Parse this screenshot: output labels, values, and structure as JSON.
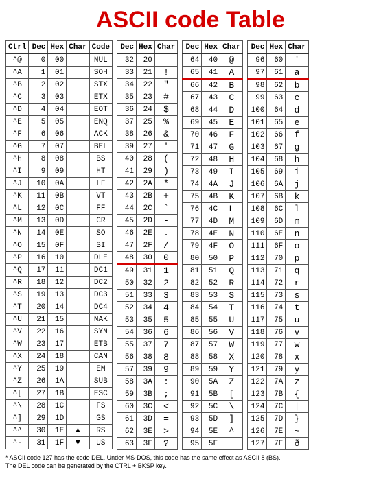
{
  "title": "ASCII code Table",
  "headers": {
    "ctrl": "Ctrl",
    "dec": "Dec",
    "hex": "Hex",
    "char": "Char",
    "code": "Code"
  },
  "footnote_1": "* ASCII code 127 has the code DEL. Under MS-DOS, this code has the same effect as ASCII 8 (BS).",
  "footnote_2": "  The DEL code can be generated by the CTRL + BKSP key.",
  "block1": [
    {
      "ctrl": "^@",
      "dec": 0,
      "hex": "00",
      "char": "",
      "code": "NUL"
    },
    {
      "ctrl": "^A",
      "dec": 1,
      "hex": "01",
      "char": "",
      "code": "SOH"
    },
    {
      "ctrl": "^B",
      "dec": 2,
      "hex": "02",
      "char": "",
      "code": "STX"
    },
    {
      "ctrl": "^C",
      "dec": 3,
      "hex": "03",
      "char": "",
      "code": "ETX"
    },
    {
      "ctrl": "^D",
      "dec": 4,
      "hex": "04",
      "char": "",
      "code": "EOT"
    },
    {
      "ctrl": "^E",
      "dec": 5,
      "hex": "05",
      "char": "",
      "code": "ENQ"
    },
    {
      "ctrl": "^F",
      "dec": 6,
      "hex": "06",
      "char": "",
      "code": "ACK"
    },
    {
      "ctrl": "^G",
      "dec": 7,
      "hex": "07",
      "char": "",
      "code": "BEL"
    },
    {
      "ctrl": "^H",
      "dec": 8,
      "hex": "08",
      "char": "",
      "code": "BS"
    },
    {
      "ctrl": "^I",
      "dec": 9,
      "hex": "09",
      "char": "",
      "code": "HT"
    },
    {
      "ctrl": "^J",
      "dec": 10,
      "hex": "0A",
      "char": "",
      "code": "LF"
    },
    {
      "ctrl": "^K",
      "dec": 11,
      "hex": "0B",
      "char": "",
      "code": "VT"
    },
    {
      "ctrl": "^L",
      "dec": 12,
      "hex": "0C",
      "char": "",
      "code": "FF"
    },
    {
      "ctrl": "^M",
      "dec": 13,
      "hex": "0D",
      "char": "",
      "code": "CR"
    },
    {
      "ctrl": "^N",
      "dec": 14,
      "hex": "0E",
      "char": "",
      "code": "SO"
    },
    {
      "ctrl": "^O",
      "dec": 15,
      "hex": "0F",
      "char": "",
      "code": "SI"
    },
    {
      "ctrl": "^P",
      "dec": 16,
      "hex": "10",
      "char": "",
      "code": "DLE"
    },
    {
      "ctrl": "^Q",
      "dec": 17,
      "hex": "11",
      "char": "",
      "code": "DC1"
    },
    {
      "ctrl": "^R",
      "dec": 18,
      "hex": "12",
      "char": "",
      "code": "DC2"
    },
    {
      "ctrl": "^S",
      "dec": 19,
      "hex": "13",
      "char": "",
      "code": "DC3"
    },
    {
      "ctrl": "^T",
      "dec": 20,
      "hex": "14",
      "char": "",
      "code": "DC4"
    },
    {
      "ctrl": "^U",
      "dec": 21,
      "hex": "15",
      "char": "",
      "code": "NAK"
    },
    {
      "ctrl": "^V",
      "dec": 22,
      "hex": "16",
      "char": "",
      "code": "SYN"
    },
    {
      "ctrl": "^W",
      "dec": 23,
      "hex": "17",
      "char": "",
      "code": "ETB"
    },
    {
      "ctrl": "^X",
      "dec": 24,
      "hex": "18",
      "char": "",
      "code": "CAN"
    },
    {
      "ctrl": "^Y",
      "dec": 25,
      "hex": "19",
      "char": "",
      "code": "EM"
    },
    {
      "ctrl": "^Z",
      "dec": 26,
      "hex": "1A",
      "char": "",
      "code": "SUB"
    },
    {
      "ctrl": "^[",
      "dec": 27,
      "hex": "1B",
      "char": "",
      "code": "ESC"
    },
    {
      "ctrl": "^\\",
      "dec": 28,
      "hex": "1C",
      "char": "",
      "code": "FS"
    },
    {
      "ctrl": "^]",
      "dec": 29,
      "hex": "1D",
      "char": "",
      "code": "GS"
    },
    {
      "ctrl": "^^",
      "dec": 30,
      "hex": "1E",
      "char": "▲",
      "code": "RS"
    },
    {
      "ctrl": "^-",
      "dec": 31,
      "hex": "1F",
      "char": "▼",
      "code": "US"
    }
  ],
  "block2": [
    {
      "dec": 32,
      "hex": "20",
      "char": " "
    },
    {
      "dec": 33,
      "hex": "21",
      "char": "!"
    },
    {
      "dec": 34,
      "hex": "22",
      "char": "\""
    },
    {
      "dec": 35,
      "hex": "23",
      "char": "#"
    },
    {
      "dec": 36,
      "hex": "24",
      "char": "$"
    },
    {
      "dec": 37,
      "hex": "25",
      "char": "%"
    },
    {
      "dec": 38,
      "hex": "26",
      "char": "&"
    },
    {
      "dec": 39,
      "hex": "27",
      "char": "'"
    },
    {
      "dec": 40,
      "hex": "28",
      "char": "("
    },
    {
      "dec": 41,
      "hex": "29",
      "char": ")"
    },
    {
      "dec": 42,
      "hex": "2A",
      "char": "*"
    },
    {
      "dec": 43,
      "hex": "2B",
      "char": "+"
    },
    {
      "dec": 44,
      "hex": "2C",
      "char": "`"
    },
    {
      "dec": 45,
      "hex": "2D",
      "char": "-"
    },
    {
      "dec": 46,
      "hex": "2E",
      "char": "."
    },
    {
      "dec": 47,
      "hex": "2F",
      "char": "/"
    },
    {
      "dec": 48,
      "hex": "30",
      "char": "0",
      "redline": true
    },
    {
      "dec": 49,
      "hex": "31",
      "char": "1"
    },
    {
      "dec": 50,
      "hex": "32",
      "char": "2"
    },
    {
      "dec": 51,
      "hex": "33",
      "char": "3"
    },
    {
      "dec": 52,
      "hex": "34",
      "char": "4"
    },
    {
      "dec": 53,
      "hex": "35",
      "char": "5"
    },
    {
      "dec": 54,
      "hex": "36",
      "char": "6"
    },
    {
      "dec": 55,
      "hex": "37",
      "char": "7"
    },
    {
      "dec": 56,
      "hex": "38",
      "char": "8"
    },
    {
      "dec": 57,
      "hex": "39",
      "char": "9"
    },
    {
      "dec": 58,
      "hex": "3A",
      "char": ":"
    },
    {
      "dec": 59,
      "hex": "3B",
      "char": ";"
    },
    {
      "dec": 60,
      "hex": "3C",
      "char": "<"
    },
    {
      "dec": 61,
      "hex": "3D",
      "char": "="
    },
    {
      "dec": 62,
      "hex": "3E",
      "char": ">"
    },
    {
      "dec": 63,
      "hex": "3F",
      "char": "?"
    }
  ],
  "block3": [
    {
      "dec": 64,
      "hex": "40",
      "char": "@"
    },
    {
      "dec": 65,
      "hex": "41",
      "char": "A",
      "redline": true
    },
    {
      "dec": 66,
      "hex": "42",
      "char": "B"
    },
    {
      "dec": 67,
      "hex": "43",
      "char": "C"
    },
    {
      "dec": 68,
      "hex": "44",
      "char": "D"
    },
    {
      "dec": 69,
      "hex": "45",
      "char": "E"
    },
    {
      "dec": 70,
      "hex": "46",
      "char": "F"
    },
    {
      "dec": 71,
      "hex": "47",
      "char": "G"
    },
    {
      "dec": 72,
      "hex": "48",
      "char": "H"
    },
    {
      "dec": 73,
      "hex": "49",
      "char": "I"
    },
    {
      "dec": 74,
      "hex": "4A",
      "char": "J"
    },
    {
      "dec": 75,
      "hex": "4B",
      "char": "K"
    },
    {
      "dec": 76,
      "hex": "4C",
      "char": "L"
    },
    {
      "dec": 77,
      "hex": "4D",
      "char": "M"
    },
    {
      "dec": 78,
      "hex": "4E",
      "char": "N"
    },
    {
      "dec": 79,
      "hex": "4F",
      "char": "O"
    },
    {
      "dec": 80,
      "hex": "50",
      "char": "P"
    },
    {
      "dec": 81,
      "hex": "51",
      "char": "Q"
    },
    {
      "dec": 82,
      "hex": "52",
      "char": "R"
    },
    {
      "dec": 83,
      "hex": "53",
      "char": "S"
    },
    {
      "dec": 84,
      "hex": "54",
      "char": "T"
    },
    {
      "dec": 85,
      "hex": "55",
      "char": "U"
    },
    {
      "dec": 86,
      "hex": "56",
      "char": "V"
    },
    {
      "dec": 87,
      "hex": "57",
      "char": "W"
    },
    {
      "dec": 88,
      "hex": "58",
      "char": "X"
    },
    {
      "dec": 89,
      "hex": "59",
      "char": "Y"
    },
    {
      "dec": 90,
      "hex": "5A",
      "char": "Z"
    },
    {
      "dec": 91,
      "hex": "5B",
      "char": "["
    },
    {
      "dec": 92,
      "hex": "5C",
      "char": "\\"
    },
    {
      "dec": 93,
      "hex": "5D",
      "char": "]"
    },
    {
      "dec": 94,
      "hex": "5E",
      "char": "^"
    },
    {
      "dec": 95,
      "hex": "5F",
      "char": "_"
    }
  ],
  "block4": [
    {
      "dec": 96,
      "hex": "60",
      "char": "'"
    },
    {
      "dec": 97,
      "hex": "61",
      "char": "a",
      "redline": true
    },
    {
      "dec": 98,
      "hex": "62",
      "char": "b"
    },
    {
      "dec": 99,
      "hex": "63",
      "char": "c"
    },
    {
      "dec": 100,
      "hex": "64",
      "char": "d"
    },
    {
      "dec": 101,
      "hex": "65",
      "char": "e"
    },
    {
      "dec": 102,
      "hex": "66",
      "char": "f"
    },
    {
      "dec": 103,
      "hex": "67",
      "char": "g"
    },
    {
      "dec": 104,
      "hex": "68",
      "char": "h"
    },
    {
      "dec": 105,
      "hex": "69",
      "char": "i"
    },
    {
      "dec": 106,
      "hex": "6A",
      "char": "j"
    },
    {
      "dec": 107,
      "hex": "6B",
      "char": "k"
    },
    {
      "dec": 108,
      "hex": "6C",
      "char": "l"
    },
    {
      "dec": 109,
      "hex": "6D",
      "char": "m"
    },
    {
      "dec": 110,
      "hex": "6E",
      "char": "n"
    },
    {
      "dec": 111,
      "hex": "6F",
      "char": "o"
    },
    {
      "dec": 112,
      "hex": "70",
      "char": "p"
    },
    {
      "dec": 113,
      "hex": "71",
      "char": "q"
    },
    {
      "dec": 114,
      "hex": "72",
      "char": "r"
    },
    {
      "dec": 115,
      "hex": "73",
      "char": "s"
    },
    {
      "dec": 116,
      "hex": "74",
      "char": "t"
    },
    {
      "dec": 117,
      "hex": "75",
      "char": "u"
    },
    {
      "dec": 118,
      "hex": "76",
      "char": "v"
    },
    {
      "dec": 119,
      "hex": "77",
      "char": "w"
    },
    {
      "dec": 120,
      "hex": "78",
      "char": "x"
    },
    {
      "dec": 121,
      "hex": "79",
      "char": "y"
    },
    {
      "dec": 122,
      "hex": "7A",
      "char": "z"
    },
    {
      "dec": 123,
      "hex": "7B",
      "char": "{"
    },
    {
      "dec": 124,
      "hex": "7C",
      "char": "|"
    },
    {
      "dec": 125,
      "hex": "7D",
      "char": "}"
    },
    {
      "dec": 126,
      "hex": "7E",
      "char": "~"
    },
    {
      "dec": 127,
      "hex": "7F",
      "char": "ð"
    }
  ]
}
